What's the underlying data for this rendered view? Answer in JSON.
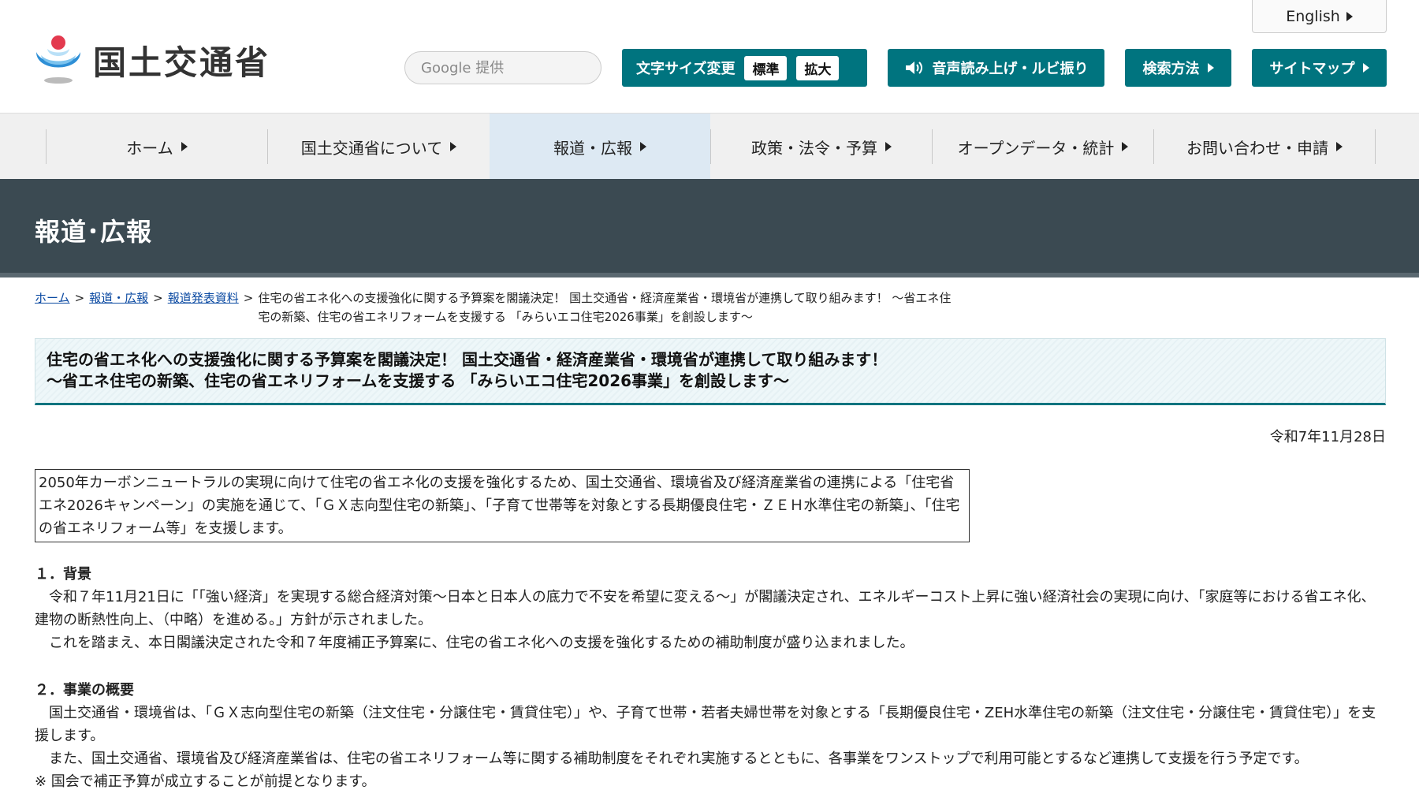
{
  "header": {
    "logo_text": "国土交通省",
    "language_label": "English",
    "search_placeholder": "Google 提供",
    "font_size_label": "文字サイズ変更",
    "font_size_standard": "標準",
    "font_size_large": "拡大",
    "speech_label": "音声読み上げ・ルビ振り",
    "search_howto_label": "検索方法",
    "sitemap_label": "サイトマップ"
  },
  "nav": {
    "items": [
      {
        "label": "ホーム"
      },
      {
        "label": "国土交通省について"
      },
      {
        "label": "報道・広報"
      },
      {
        "label": "政策・法令・予算"
      },
      {
        "label": "オープンデータ・統計"
      },
      {
        "label": "お問い合わせ・申請"
      }
    ],
    "active_index": 2
  },
  "banner": {
    "title": "報道･広報"
  },
  "breadcrumb": {
    "home": "ホーム",
    "press": "報道・広報",
    "materials": "報道発表資料",
    "current": "住宅の省エネ化への支援強化に関する予算案を閣議決定！ 国土交通省・経済産業省・環境省が連携して取り組みます！ ～省エネ住宅の新築、住宅の省エネリフォームを支援する 「みらいエコ住宅2026事業」を創設します～"
  },
  "article": {
    "title_line1": "住宅の省エネ化への支援強化に関する予算案を閣議決定！ 国土交通省・経済産業省・環境省が連携して取り組みます！",
    "title_line2": "～省エネ住宅の新築、住宅の省エネリフォームを支援する 「みらいエコ住宅2026事業」を創設します～",
    "date": "令和7年11月28日",
    "lead": "2050年カーボンニュートラルの実現に向けて住宅の省エネ化の支援を強化するため、国土交通省、環境省及び経済産業省の連携による「住宅省エネ2026キャンペーン」の実施を通じて、「ＧＸ志向型住宅の新築」、「子育て世帯等を対象とする長期優良住宅・ＺＥＨ水準住宅の新築」、「住宅の省エネリフォーム等」を支援します。",
    "section1_heading": "１．背景",
    "section1_p1": "令和７年11月21日に「「強い経済」を実現する総合経済対策～日本と日本人の底力で不安を希望に変える～」が閣議決定され、エネルギーコスト上昇に強い経済社会の実現に向け、「家庭等における省エネ化、建物の断熱性向上、（中略）を進める。」方針が示されました。",
    "section1_p2": "これを踏まえ、本日閣議決定された令和７年度補正予算案に、住宅の省エネ化への支援を強化するための補助制度が盛り込まれました。",
    "section2_heading": "２．事業の概要",
    "section2_p1": "国土交通省・環境省は、「ＧＸ志向型住宅の新築（注文住宅・分譲住宅・賃貸住宅）」や、子育て世帯・若者夫婦世帯を対象とする「長期優良住宅・ZEH水準住宅の新築（注文住宅・分譲住宅・賃貸住宅）」を支援します。",
    "section2_p2": "また、国土交通省、環境省及び経済産業省は、住宅の省エネリフォーム等に関する補助制度をそれぞれ実施するとともに、各事業をワンストップで利用可能とするなど連携して支援を行う予定です。",
    "section2_note": "※ 国会で補正予算が成立することが前提となります。"
  },
  "colors": {
    "teal": "#00747f",
    "banner": "#3b4a52",
    "nav_bg": "#f0f0f0",
    "nav_active": "#dde9f3",
    "link": "#0b4aa2"
  }
}
